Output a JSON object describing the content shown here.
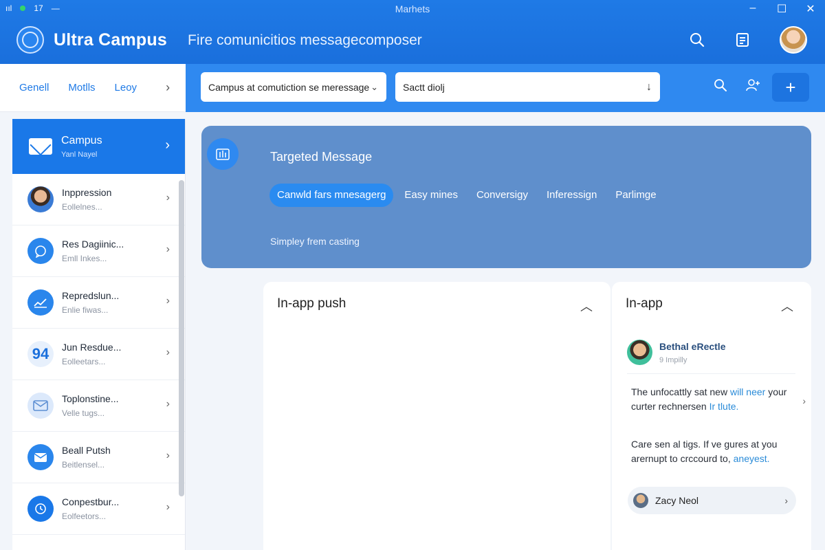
{
  "window": {
    "title": "Marhets",
    "status_signal": "ııl",
    "status_time": "17",
    "controls": {
      "minimize": "–",
      "maximize": "☐",
      "close": "✕"
    }
  },
  "header": {
    "brand": "Ultra Campus",
    "subtitle": "Fire comunicitios messagecomposer"
  },
  "left_tabs": [
    "Genell",
    "Motlls",
    "Leoy"
  ],
  "sidebar": {
    "active": {
      "title": "Campus",
      "subtitle": "Yanl Nayel"
    },
    "items": [
      {
        "title": "Inppression",
        "subtitle": "Eollelnes...",
        "icon": "person-avatar"
      },
      {
        "title": "Res Dagiinic...",
        "subtitle": "Emll Inkes...",
        "icon": "chat-icon"
      },
      {
        "title": "Repredslun...",
        "subtitle": "Enlie fiwas...",
        "icon": "chart-icon"
      },
      {
        "title": "Jun Resdue...",
        "subtitle": "Eolleetars...",
        "icon": "number-badge",
        "badge": "94"
      },
      {
        "title": "Toplonstine...",
        "subtitle": "Velle tugs...",
        "icon": "mail-outline-icon"
      },
      {
        "title": "Beall Putsh",
        "subtitle": "Beitlensel...",
        "icon": "mail-icon"
      },
      {
        "title": "Conpestbur...",
        "subtitle": "Eolfeetors...",
        "icon": "refresh-icon"
      }
    ]
  },
  "toolbar": {
    "select_value": "Campus at comutiction se meressage",
    "search_value": "Sactt diolj"
  },
  "hero": {
    "title": "Targeted Message",
    "tabs": [
      "Canwld fars mnesagerg",
      "Easy mines",
      "Conversigy",
      "Inferessign",
      "Parlimge"
    ],
    "active_tab": 0,
    "note": "Simpley frem casting"
  },
  "panels": {
    "left": {
      "title": "In-app push"
    },
    "right": {
      "title": "In-app",
      "sender": "Bethal eRectle",
      "sender_meta": "9 Impilly",
      "para1_text": "The unfocattly sat new ",
      "para1_link1": "will neer",
      "para1_text2": "your curter rechnersen ",
      "para1_link2": "Ir tlute.",
      "para2_text": "Care sen al tigs. If ve gures at you arernupt to crccourd to, ",
      "para2_link": "aneyest.",
      "contact": "Zacy Neol"
    }
  },
  "colors": {
    "primary": "#1a78e8",
    "hero": "#5f8fcc",
    "link": "#2a8bd8"
  }
}
